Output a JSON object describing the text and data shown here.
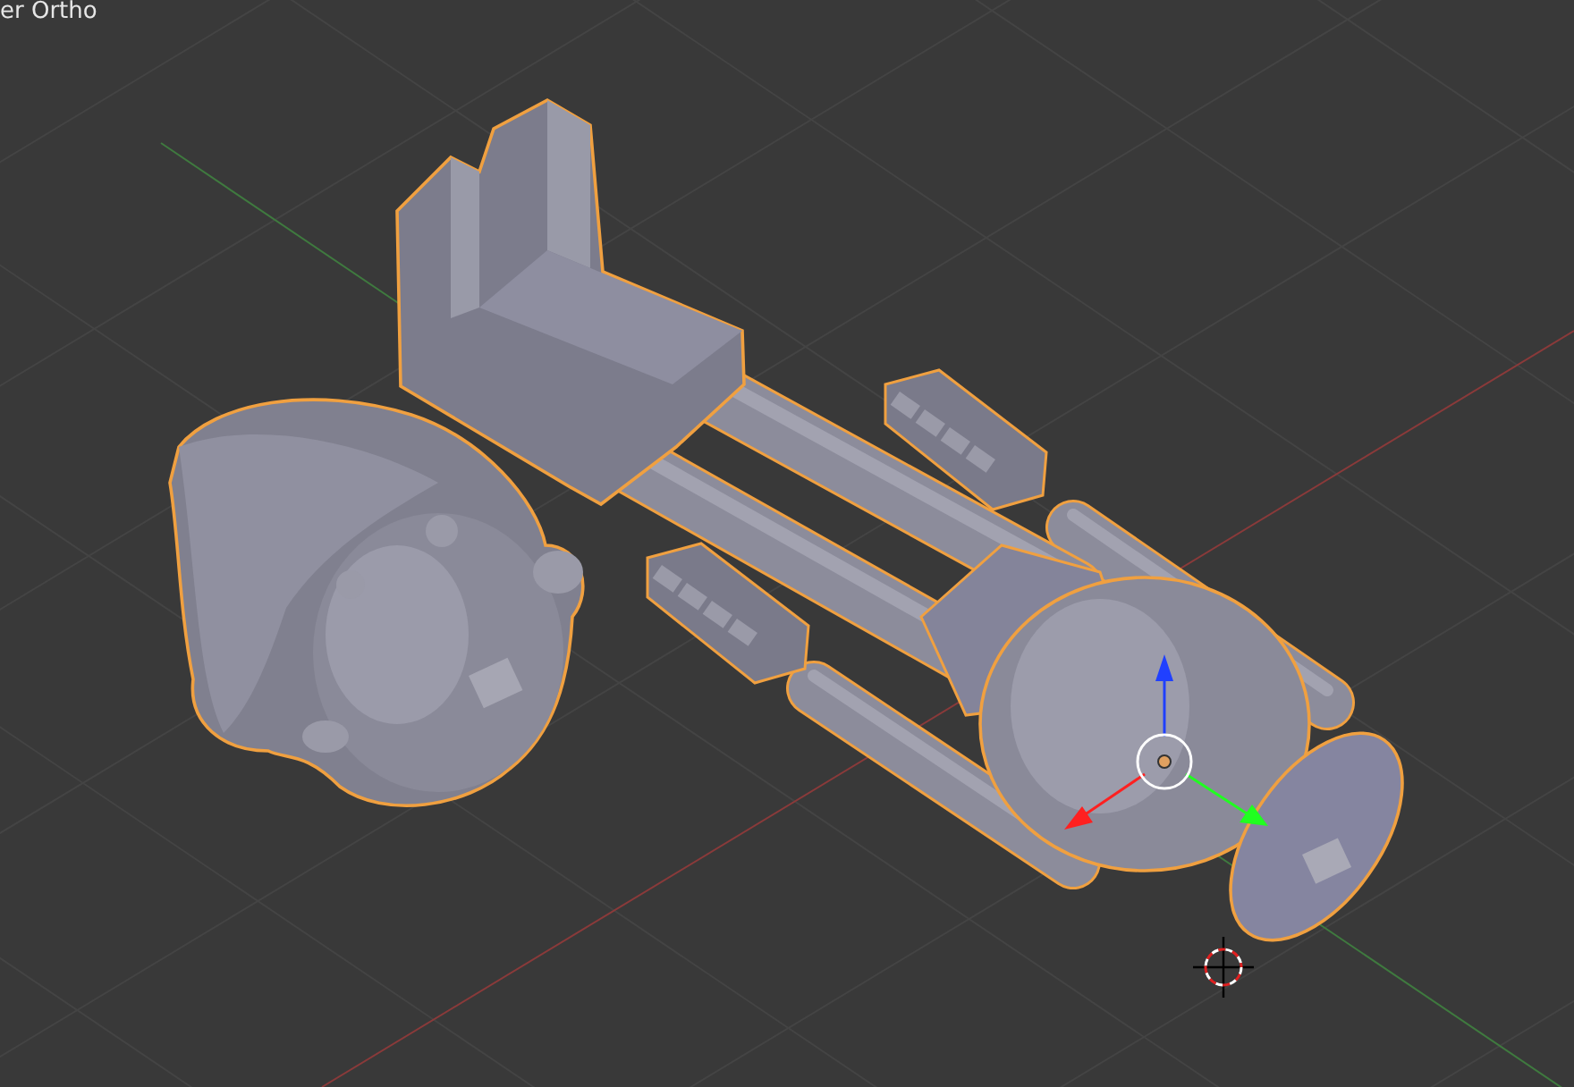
{
  "viewport": {
    "view_label": "er Ortho"
  }
}
